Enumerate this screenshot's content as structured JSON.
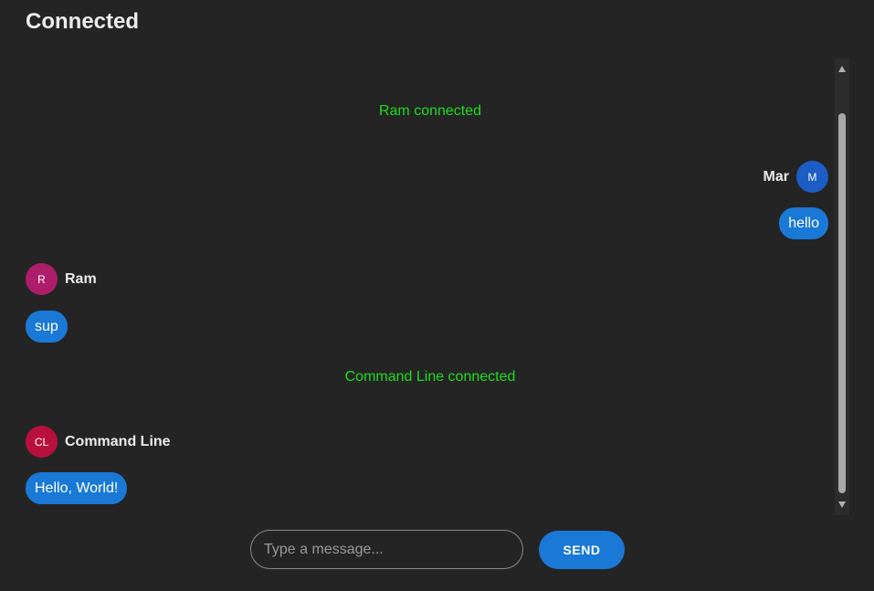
{
  "header": {
    "status": "Connected"
  },
  "messages": {
    "system": [
      {
        "text": "Ram connected"
      },
      {
        "text": "Command Line connected"
      }
    ],
    "chat": [
      {
        "user": "Mar",
        "initials": "M",
        "text": "hello",
        "side": "right",
        "avatar_color": "#1b5dc5"
      },
      {
        "user": "Ram",
        "initials": "R",
        "text": "sup",
        "side": "left",
        "avatar_color": "#ad1d6a"
      },
      {
        "user": "Command Line",
        "initials": "CL",
        "text": "Hello, World!",
        "side": "left",
        "avatar_color": "#b8103d"
      }
    ]
  },
  "composer": {
    "placeholder": "Type a message...",
    "value": "",
    "send_label": "SEND"
  },
  "colors": {
    "background": "#242424",
    "bubble": "#1a79d6",
    "system_text": "#1fdc1f"
  }
}
